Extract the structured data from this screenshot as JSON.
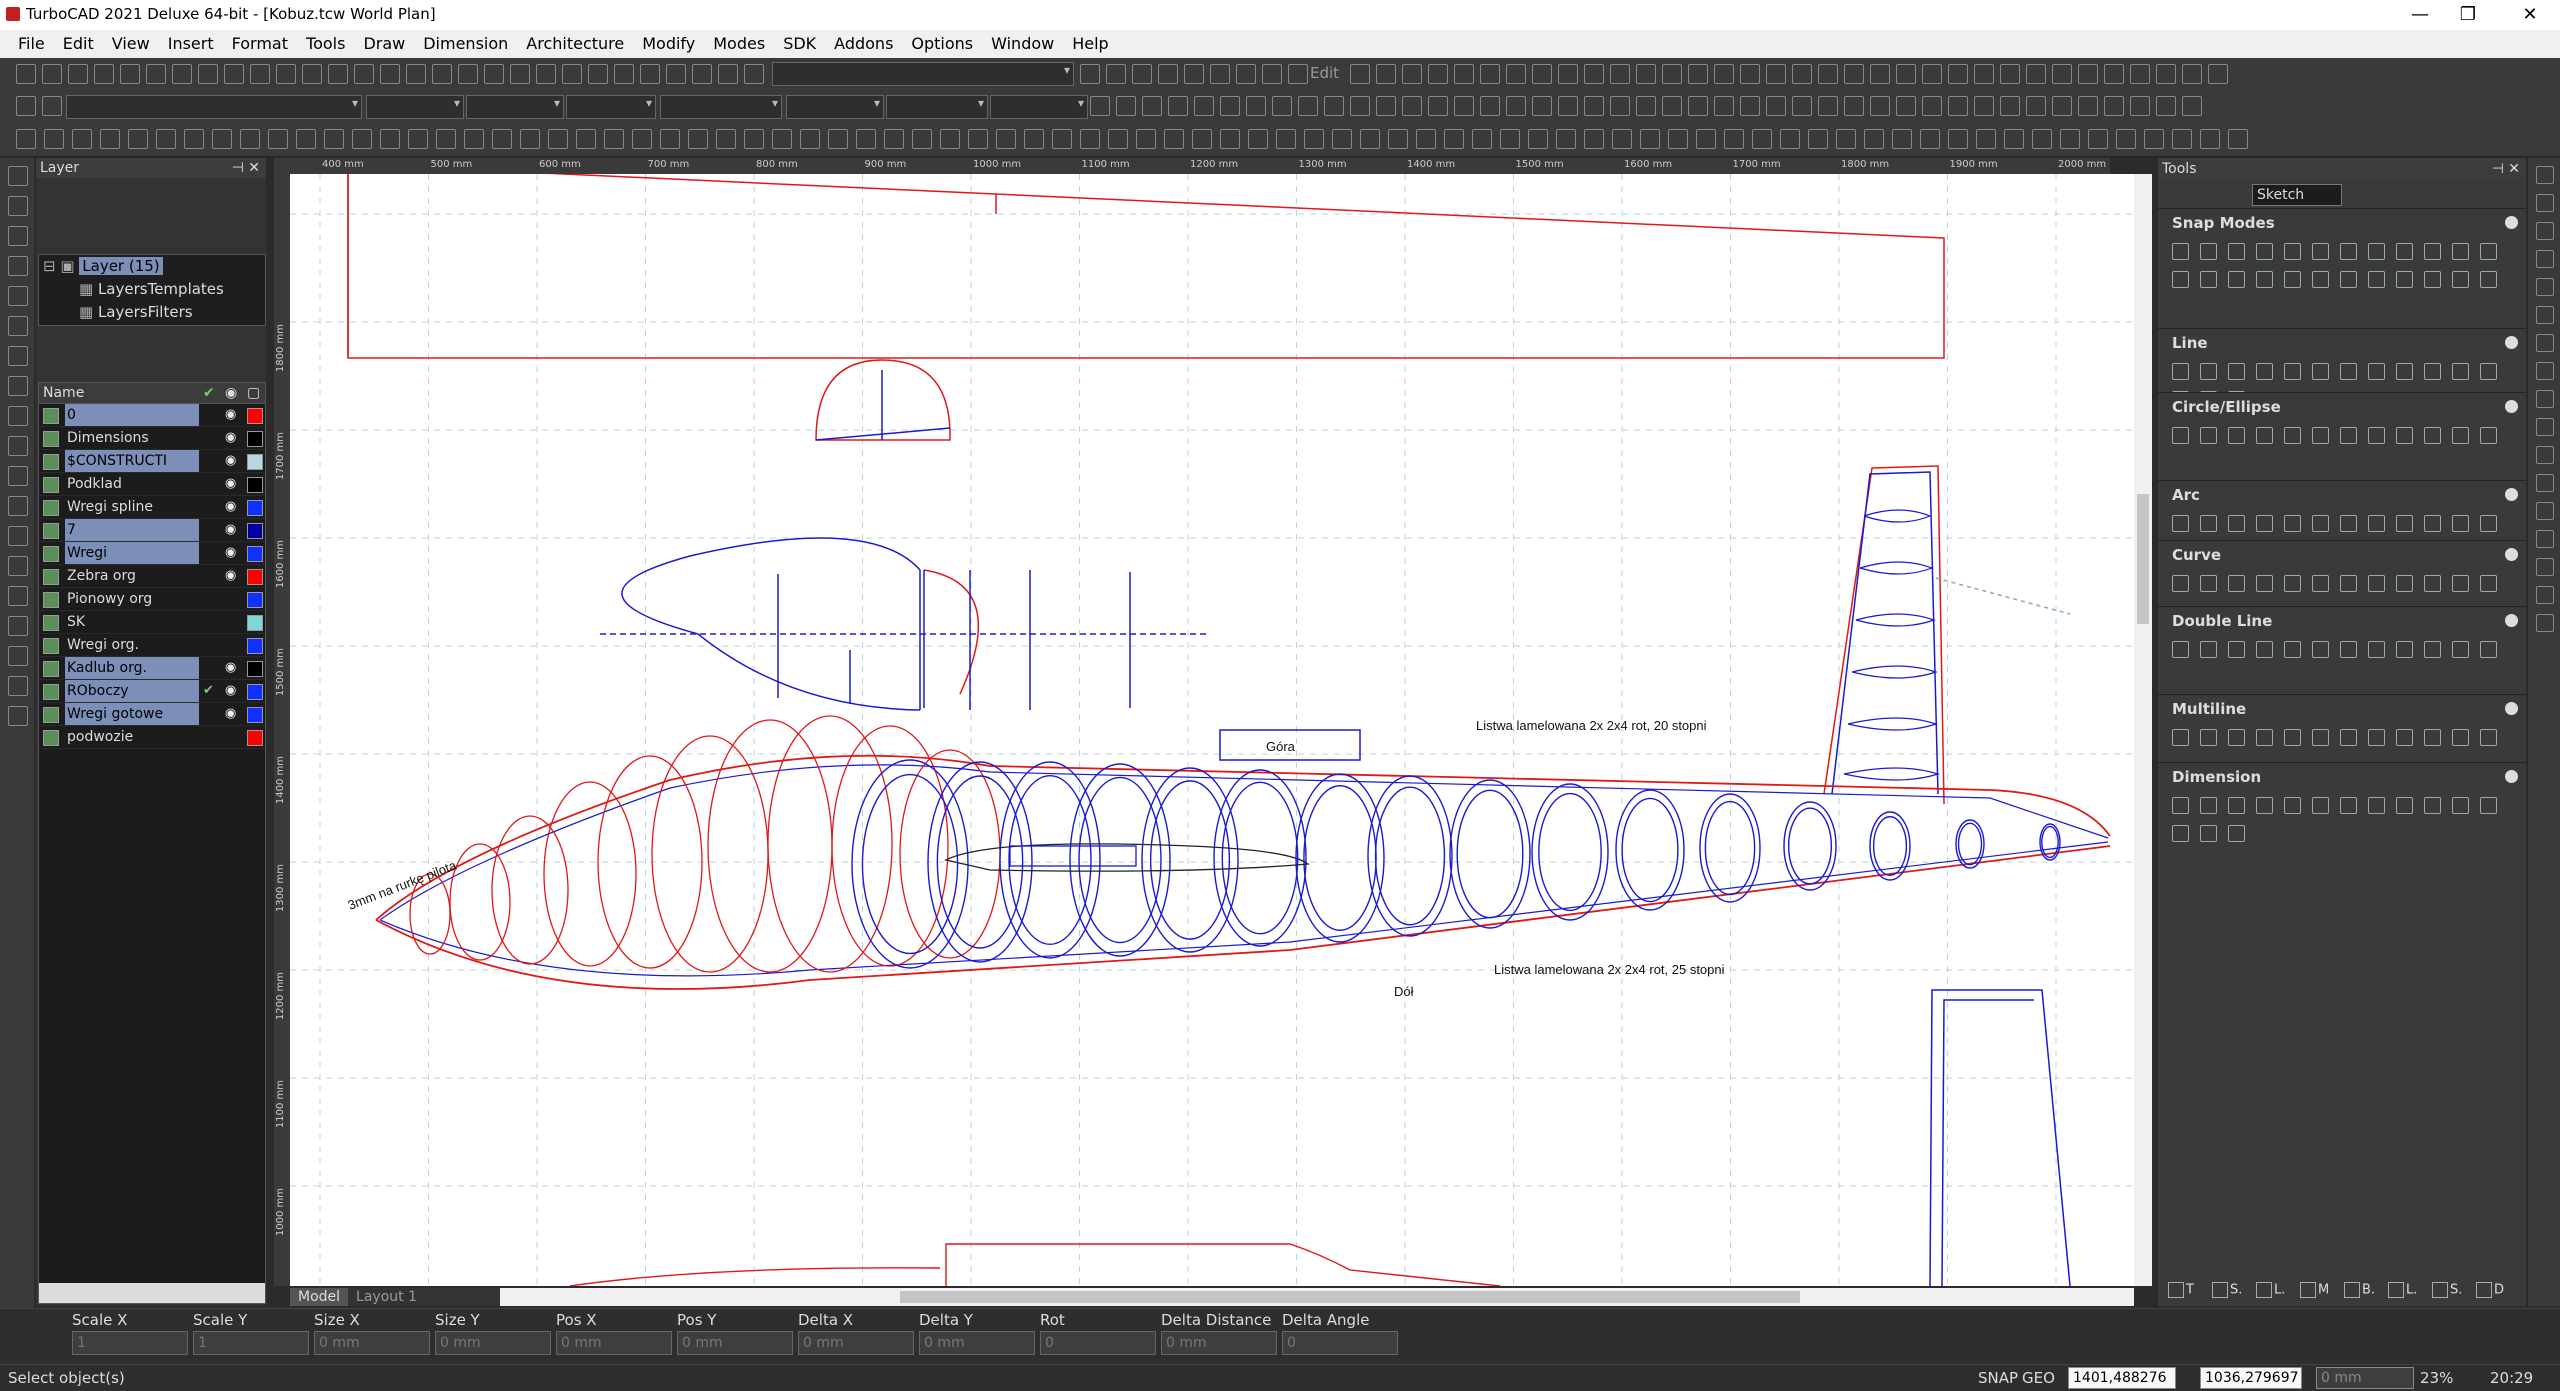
{
  "window": {
    "title": "TurboCAD 2021 Deluxe 64-bit - [Kobuz.tcw World Plan]",
    "minimize": "—",
    "maximize": "❐",
    "close": "✕"
  },
  "menu": {
    "items": [
      "File",
      "Edit",
      "View",
      "Insert",
      "Format",
      "Tools",
      "Draw",
      "Dimension",
      "Architecture",
      "Modify",
      "Modes",
      "SDK",
      "Addons",
      "Options",
      "Window",
      "Help"
    ]
  },
  "toolbar": {
    "edit_label": "Edit"
  },
  "layer_panel": {
    "title": "Layer",
    "tree": {
      "root": "Layer (15)",
      "children": [
        "LayersTemplates",
        "LayersFilters"
      ]
    },
    "columns": {
      "name": "Name"
    },
    "layers": [
      {
        "name": "0",
        "selected": true,
        "visible": true,
        "active": false,
        "color": "#ff0000"
      },
      {
        "name": "Dimensions",
        "selected": false,
        "visible": true,
        "active": false,
        "color": "#000000"
      },
      {
        "name": "$CONSTRUCTI",
        "selected": true,
        "visible": true,
        "active": false,
        "color": "#b8d8e0"
      },
      {
        "name": "Podklad",
        "selected": false,
        "visible": true,
        "active": false,
        "color": "#000000"
      },
      {
        "name": "Wregi spline",
        "selected": false,
        "visible": true,
        "active": false,
        "color": "#1030ff"
      },
      {
        "name": "7",
        "selected": true,
        "visible": true,
        "active": false,
        "color": "#0000a0"
      },
      {
        "name": "Wregi",
        "selected": true,
        "visible": true,
        "active": false,
        "color": "#1030ff"
      },
      {
        "name": "Zebra org",
        "selected": false,
        "visible": true,
        "active": false,
        "color": "#ff0000"
      },
      {
        "name": "Pionowy org",
        "selected": false,
        "visible": false,
        "active": false,
        "color": "#1030ff"
      },
      {
        "name": "SK",
        "selected": false,
        "visible": false,
        "active": false,
        "color": "#7fd8d8"
      },
      {
        "name": "Wregi org.",
        "selected": false,
        "visible": false,
        "active": false,
        "color": "#1030ff"
      },
      {
        "name": "Kadlub org.",
        "selected": true,
        "visible": true,
        "active": false,
        "color": "#000000"
      },
      {
        "name": "ROboczy",
        "selected": true,
        "visible": true,
        "active": true,
        "color": "#1030ff"
      },
      {
        "name": "Wregi gotowe",
        "selected": true,
        "visible": true,
        "active": false,
        "color": "#1030ff"
      },
      {
        "name": "podwozie",
        "selected": false,
        "visible": false,
        "active": false,
        "color": "#ff0000"
      }
    ]
  },
  "ruler": {
    "top_labels": [
      "400 mm",
      "500 mm",
      "600 mm",
      "700 mm",
      "800 mm",
      "900 mm",
      "1000 mm",
      "1100 mm",
      "1200 mm",
      "1300 mm",
      "1400 mm",
      "1500 mm",
      "1600 mm",
      "1700 mm",
      "1800 mm",
      "1900 mm",
      "2000 mm"
    ],
    "left_labels": [
      "1800 mm",
      "1700 mm",
      "1600 mm",
      "1500 mm",
      "1400 mm",
      "1300 mm",
      "1200 mm",
      "1100 mm",
      "1000 mm"
    ]
  },
  "drawing": {
    "annotations": {
      "listwa_top": "Listwa lamelowana 2x 2x4 rot, 20 stopni",
      "listwa_bottom": "Listwa lamelowana 2x 2x4 rot, 25 stopni",
      "gora": "Góra",
      "dol": "Dół",
      "rurka": "3mm na rurkę pilota"
    }
  },
  "tabs": [
    "Model",
    "Layout 1"
  ],
  "tools_panel": {
    "title": "Tools",
    "mode": "Sketch",
    "sections": [
      "Snap Modes",
      "Line",
      "Circle/Ellipse",
      "Arc",
      "Curve",
      "Double Line",
      "Multiline",
      "Dimension"
    ],
    "bottom_tabs": [
      "T",
      "S.",
      "L.",
      "M",
      "B.",
      "L.",
      "S.",
      "D"
    ]
  },
  "inspector": {
    "fields": [
      {
        "label": "Scale X",
        "value": "1"
      },
      {
        "label": "Scale Y",
        "value": "1"
      },
      {
        "label": "Size X",
        "value": "0 mm"
      },
      {
        "label": "Size Y",
        "value": "0 mm"
      },
      {
        "label": "Pos X",
        "value": "0 mm"
      },
      {
        "label": "Pos Y",
        "value": "0 mm"
      },
      {
        "label": "Delta X",
        "value": "0 mm"
      },
      {
        "label": "Delta Y",
        "value": "0 mm"
      },
      {
        "label": "Rot",
        "value": "0"
      },
      {
        "label": "Delta Distance",
        "value": "0 mm"
      },
      {
        "label": "Delta Angle",
        "value": "0"
      }
    ]
  },
  "status": {
    "message": "Select object(s)",
    "snap": "SNAP",
    "geo": "GEO",
    "coord_x": "1401,488276",
    "coord_y": "1036,279697",
    "coord_z": "0 mm",
    "zoom": "23%",
    "time": "20:29"
  },
  "colors": {
    "accent": "#7b8fb8",
    "red_drawing": "#e01818",
    "blue_drawing": "#1a1ad0"
  }
}
